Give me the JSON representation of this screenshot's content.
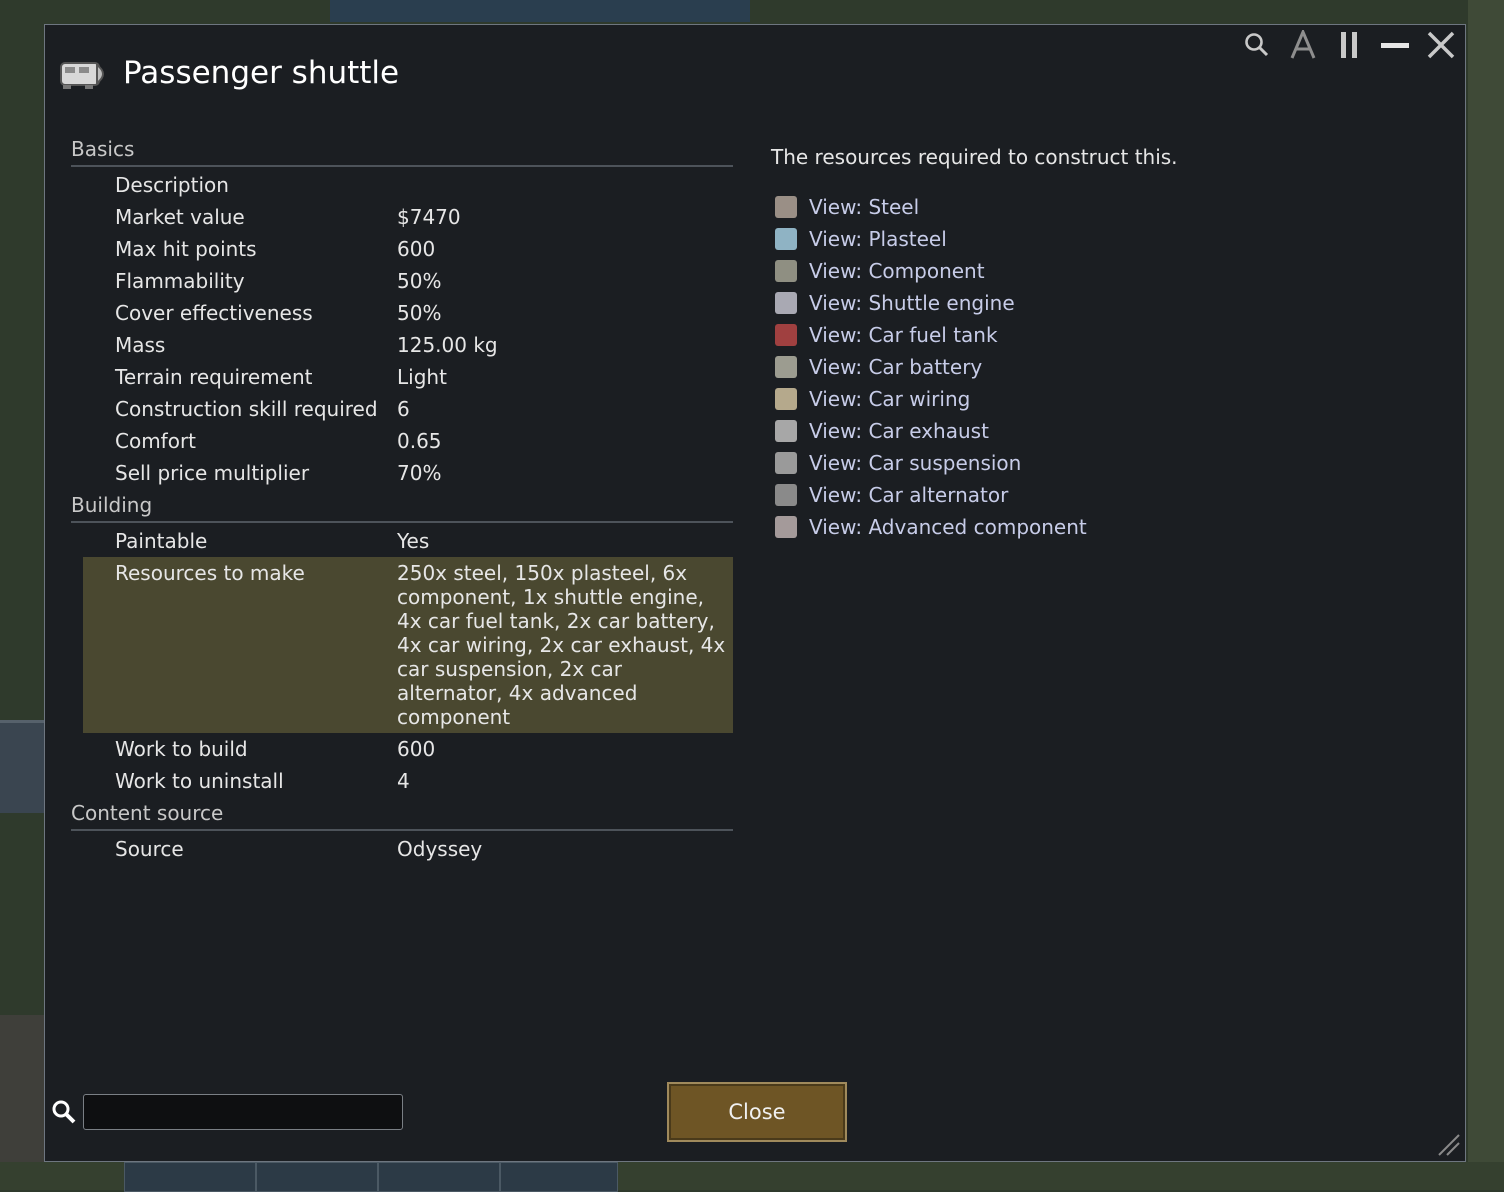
{
  "window": {
    "title": "Passenger shuttle",
    "controls": [
      "search-icon",
      "font-a-icon",
      "pause-icon",
      "minimize-icon",
      "close-icon"
    ]
  },
  "stats": {
    "sections": [
      {
        "header": "Basics",
        "rows": [
          {
            "k": "Description",
            "v": ""
          },
          {
            "k": "Market value",
            "v": "$7470"
          },
          {
            "k": "Max hit points",
            "v": "600"
          },
          {
            "k": "Flammability",
            "v": "50%"
          },
          {
            "k": "Cover effectiveness",
            "v": "50%"
          },
          {
            "k": "Mass",
            "v": "125.00 kg"
          },
          {
            "k": "Terrain requirement",
            "v": "Light"
          },
          {
            "k": "Construction skill required",
            "v": "6"
          },
          {
            "k": "Comfort",
            "v": "0.65"
          },
          {
            "k": "Sell price multiplier",
            "v": "70%"
          }
        ]
      },
      {
        "header": "Building",
        "rows": [
          {
            "k": "Paintable",
            "v": "Yes"
          },
          {
            "k": "Resources to make",
            "v": "250x steel, 150x plasteel, 6x component, 1x shuttle engine, 4x car fuel tank, 2x car battery, 4x car wiring, 2x car exhaust, 4x car suspension, 2x car alternator, 4x advanced component",
            "selected": true
          },
          {
            "k": "Work to build",
            "v": "600"
          },
          {
            "k": "Work to uninstall",
            "v": "4"
          }
        ]
      },
      {
        "header": "Content source",
        "rows": [
          {
            "k": "Source",
            "v": "Odyssey"
          }
        ]
      }
    ]
  },
  "detail": {
    "description": "The resources required to construct this.",
    "links": [
      {
        "label": "View: Steel",
        "icon": "steel-icon",
        "color": "#9a8f86"
      },
      {
        "label": "View: Plasteel",
        "icon": "plasteel-icon",
        "color": "#8fb3c4"
      },
      {
        "label": "View: Component",
        "icon": "component-icon",
        "color": "#8f8f82"
      },
      {
        "label": "View: Shuttle engine",
        "icon": "shuttle-engine-icon",
        "color": "#a9a9b3"
      },
      {
        "label": "View: Car fuel tank",
        "icon": "fuel-tank-icon",
        "color": "#a04040"
      },
      {
        "label": "View: Car battery",
        "icon": "battery-icon",
        "color": "#9c9c90"
      },
      {
        "label": "View: Car wiring",
        "icon": "wiring-icon",
        "color": "#b5a98c"
      },
      {
        "label": "View: Car exhaust",
        "icon": "exhaust-icon",
        "color": "#a7a7a7"
      },
      {
        "label": "View: Car suspension",
        "icon": "suspension-icon",
        "color": "#9a9a9a"
      },
      {
        "label": "View: Car alternator",
        "icon": "alternator-icon",
        "color": "#8a8a8a"
      },
      {
        "label": "View: Advanced component",
        "icon": "advanced-component-icon",
        "color": "#a49a9a"
      }
    ]
  },
  "search": {
    "value": "",
    "placeholder": ""
  },
  "close_label": "Close"
}
